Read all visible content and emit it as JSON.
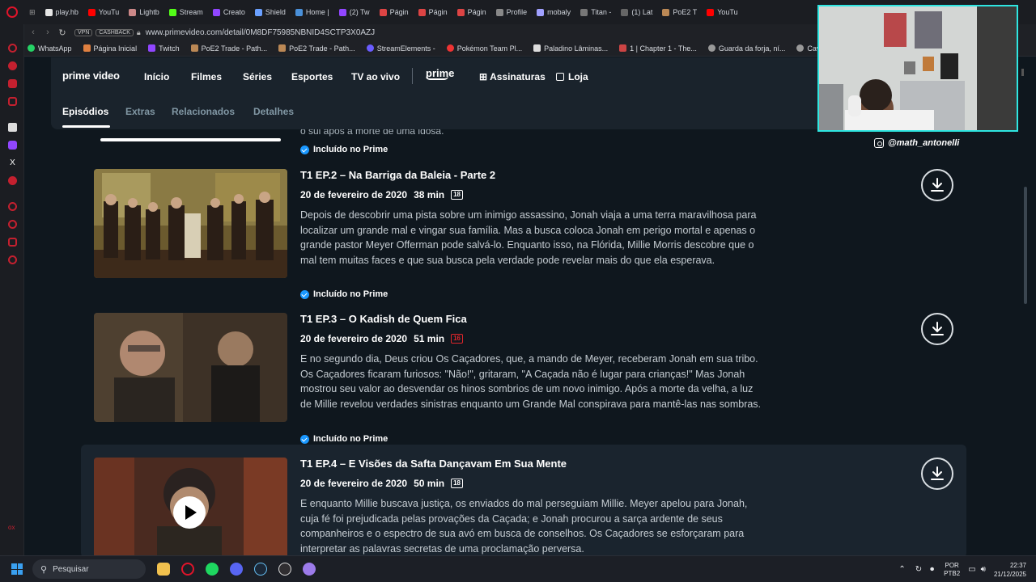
{
  "browser": {
    "tabs": [
      "play.hb",
      "YouTu",
      "Lightb",
      "Stream",
      "Creato",
      "Shield",
      "Home |",
      "(2) Tw",
      "Págin",
      "Págin",
      "Págin",
      "Profile",
      "mobaly",
      "Titan -",
      "(1) Lat",
      "PoE2 T",
      "YouTu"
    ],
    "url": "www.primevideo.com/detail/0M8DF75985NBNID4SCTP3X0AZJ",
    "vpn_label": "VPN",
    "cashback_label": "CASHBACK",
    "bookmarks": [
      "WhatsApp",
      "Página Inicial",
      "Twitch",
      "PoE2 Trade - Path...",
      "PoE2 Trade - Path...",
      "StreamElements -",
      "Pokémon Team Pl...",
      "Paladino Lâminas...",
      "1 | Chapter 1 - The...",
      "Guarda da forja, ní...",
      "Cavaleiro do Vác"
    ]
  },
  "prime": {
    "logo": "prime video",
    "nav": [
      "Início",
      "Filmes",
      "Séries",
      "Esportes",
      "TV ao vivo"
    ],
    "prime_label": "prime",
    "subscriptions": "Assinaturas",
    "store": "Loja",
    "subnav": [
      "Episódios",
      "Extras",
      "Relacionados",
      "Detalhes"
    ],
    "prev_episode_tail": "o sul após a morte de uma idosa.",
    "included": "Incluído no Prime",
    "episodes": [
      {
        "title": "T1 EP.2 – Na Barriga da Baleia - Parte 2",
        "date": "20 de fevereiro de 2020",
        "duration": "38 min",
        "rating": "18",
        "description": "Depois de descobrir uma pista sobre um inimigo assassino, Jonah viaja a uma terra maravilhosa para localizar um grande mal e vingar sua família. Mas a busca coloca Jonah em perigo mortal e apenas o grande pastor Meyer Offerman pode salvá-lo. Enquanto isso, na Flórida, Millie Morris descobre que o mal tem muitas faces e que sua busca pela verdade pode revelar mais do que ela esperava."
      },
      {
        "title": "T1 EP.3 – O Kadish de Quem Fica",
        "date": "20 de fevereiro de 2020",
        "duration": "51 min",
        "rating": "16",
        "description": "E no segundo dia, Deus criou Os Caçadores, que, a mando de Meyer, receberam Jonah em sua tribo. Os Caçadores ficaram furiosos: \"Não!\", gritaram, \"A Caçada não é lugar para crianças!\" Mas Jonah mostrou seu valor ao desvendar os hinos sombrios de um novo inimigo. Após a morte da velha, a luz de Millie revelou verdades sinistras enquanto um Grande Mal conspirava para mantê-las nas sombras."
      },
      {
        "title": "T1 EP.4 – E Visões da Safta Dançavam Em Sua Mente",
        "date": "20 de fevereiro de 2020",
        "duration": "50 min",
        "rating": "18",
        "description": "E enquanto Millie buscava justiça, os enviados do mal perseguiam Millie. Meyer apelou para Jonah, cuja fé foi prejudicada pelas provações da Caçada; e Jonah procurou a sarça ardente de seus companheiros e o espectro de sua avó em busca de conselhos. Os Caçadores se esforçaram para interpretar as palavras secretas de uma proclamação perversa."
      }
    ]
  },
  "webcam": {
    "handle": "@math_antonelli"
  },
  "taskbar": {
    "search_placeholder": "Pesquisar",
    "lang_top": "POR",
    "lang_bottom": "PTB2",
    "time": "22:37",
    "date": "21/12/2025"
  },
  "colors": {
    "accent": "#1a98ff",
    "rating_red": "#e0262b",
    "webcam_border": "#2ee6e1",
    "opera_red": "#e0142a"
  }
}
